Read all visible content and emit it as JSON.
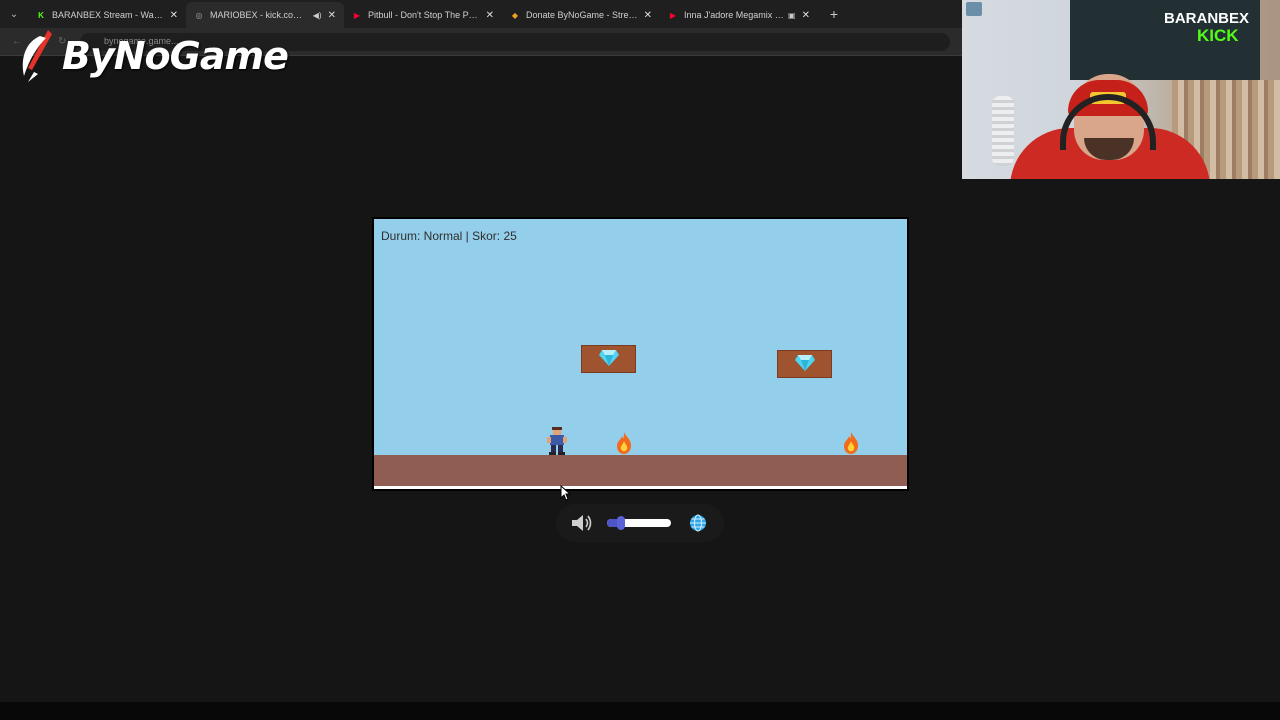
{
  "browser": {
    "tabs": [
      {
        "title": "BARANBEX Stream - Watch Live",
        "icon": "kick-icon",
        "icon_glyph": "K",
        "icon_color": "#53fc18",
        "active": false
      },
      {
        "title": "MARIOBEX - kick.com/baranbex",
        "icon": "globe-icon",
        "icon_glyph": "◎",
        "icon_color": "#9aa0a6",
        "active": true
      },
      {
        "title": "Pitbull - Don't Stop The Party (",
        "icon": "youtube-icon",
        "icon_glyph": "▶",
        "icon_color": "#ff0033",
        "active": false
      },
      {
        "title": "Donate ByNoGame - Streamer",
        "icon": "bynogame-icon",
        "icon_glyph": "◆",
        "icon_color": "#f0a020",
        "active": false
      },
      {
        "title": "Inna J'adore Megamix alessio",
        "icon": "youtube-icon",
        "icon_glyph": "▶",
        "icon_color": "#ff0033",
        "active": false
      }
    ],
    "address": "bynogame.game..."
  },
  "logo": {
    "text": "ByNoGame",
    "accent_color": "#e5332a"
  },
  "webcam": {
    "banner_line1": "BARANBEX",
    "banner_line2": "KICK"
  },
  "game": {
    "hud": "Durum: Normal | Skor: 25",
    "sky_color": "#93cfea",
    "ground_color": "#8f5d52",
    "block_color": "#a0532f",
    "gem_color": "#4fd4f2",
    "fire_color": "#f26b1d"
  },
  "controls": {
    "volume_level": 0.15,
    "accent_color": "#4f55c7"
  }
}
